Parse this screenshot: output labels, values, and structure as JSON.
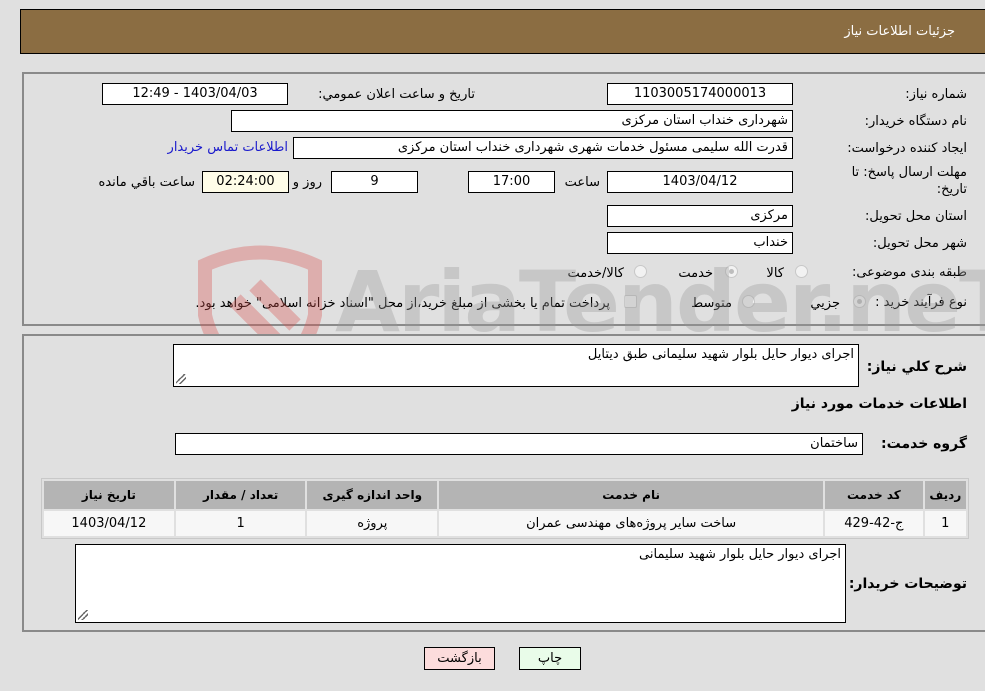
{
  "header": {
    "title": "جزئیات اطلاعات نیاز"
  },
  "form": {
    "need_number": {
      "label": "شماره نیاز:",
      "value": "1103005174000013"
    },
    "announce_datetime": {
      "label": "تاریخ و ساعت اعلان عمومي:",
      "value": "1403/04/03 - 12:49"
    },
    "buyer_org": {
      "label": "نام دستگاه خریدار:",
      "value": "شهرداری خنداب استان مرکزی"
    },
    "requester": {
      "label": "ایجاد کننده درخواست:",
      "value": "قدرت الله سلیمی مسئول خدمات شهری شهرداری خنداب استان مرکزی"
    },
    "buyer_contact_link": "اطلاعات تماس خریدار",
    "deadline": {
      "label_line1": "مهلت ارسال پاسخ: تا",
      "label_line2": "تاریخ:",
      "date": "1403/04/12",
      "time_label": "ساعت",
      "time": "17:00",
      "days": "9",
      "days_label": "روز و",
      "remaining": "02:24:00",
      "remaining_label": "ساعت باقي مانده"
    },
    "delivery_province": {
      "label": "استان محل تحویل:",
      "value": "مرکزی"
    },
    "delivery_city": {
      "label": "شهر محل تحویل:",
      "value": "خنداب"
    },
    "category": {
      "label": "طبقه بندی موضوعی:",
      "options": [
        "کالا",
        "خدمت",
        "کالا/خدمت"
      ],
      "selected": "خدمت"
    },
    "purchase_type": {
      "label": "نوع فرآیند خرید :",
      "options": [
        "جزیي",
        "متوسط"
      ],
      "selected": "جزیي",
      "treasury_note": "پرداخت تمام یا بخشی از مبلغ خرید،از محل \"اسناد خزانه اسلامی\" خواهد بود."
    }
  },
  "details": {
    "summary_label": "شرح کلي نياز:",
    "summary_value": "اجرای دیوار حایل بلوار شهید سلیمانی  طبق دیتایل",
    "services_heading": "اطلاعات خدمات مورد نياز",
    "service_group_label": "گروه خدمت:",
    "service_group_value": "ساختمان",
    "table": {
      "headers": [
        "رديف",
        "کد خدمت",
        "نام خدمت",
        "واحد اندازه گيری",
        "تعداد / مقدار",
        "تاريخ نياز"
      ],
      "rows": [
        [
          "1",
          "ج-42-429",
          "ساخت سایر پروژه‌های مهندسی عمران",
          "پروژه",
          "1",
          "1403/04/12"
        ]
      ]
    },
    "buyer_notes_label": "توضيحات خريدار:",
    "buyer_notes_value": "اجرای دیوار حایل بلوار شهید سلیمانی"
  },
  "buttons": {
    "print": "چاپ",
    "back": "بازگشت"
  },
  "watermark": {
    "text": "AriaTender.neT"
  }
}
